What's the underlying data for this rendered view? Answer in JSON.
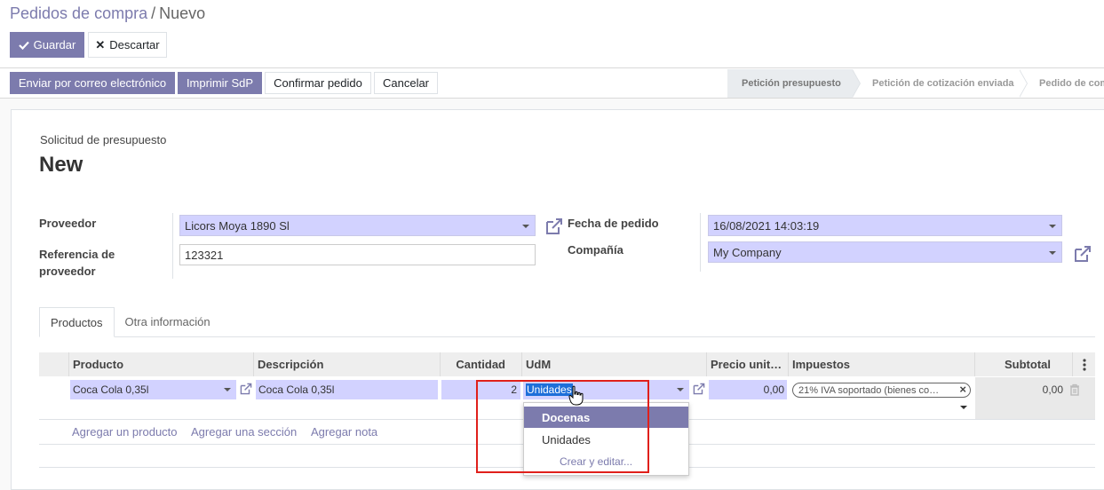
{
  "breadcrumb": {
    "parent": "Pedidos de compra",
    "separator": "/",
    "current": "Nuevo"
  },
  "toolbar": {
    "save_label": "Guardar",
    "discard_label": "Descartar"
  },
  "actions": {
    "email_label": "Enviar por correo electrónico",
    "print_label": "Imprimir SdP",
    "confirm_label": "Confirmar pedido",
    "cancel_label": "Cancelar"
  },
  "statusbar": [
    {
      "label": "Petición presupuesto",
      "active": true
    },
    {
      "label": "Petición de cotización enviada",
      "active": false
    },
    {
      "label": "Pedido de compra",
      "active": false
    }
  ],
  "form": {
    "subtitle": "Solicitud de presupuesto",
    "title": "New",
    "vendor_label": "Proveedor",
    "vendor_value": "Licors Moya 1890 Sl",
    "vendor_ref_label": "Referencia de proveedor",
    "vendor_ref_value": "123321",
    "order_date_label": "Fecha de pedido",
    "order_date_value": "16/08/2021 14:03:19",
    "company_label": "Compañía",
    "company_value": "My Company"
  },
  "tabs": [
    {
      "label": "Productos",
      "active": true
    },
    {
      "label": "Otra información",
      "active": false
    }
  ],
  "table": {
    "columns": [
      "Producto",
      "Descripción",
      "Cantidad",
      "UdM",
      "Precio unit…",
      "Impuestos",
      "Subtotal"
    ],
    "row": {
      "product": "Coca Cola 0,35l",
      "description": "Coca Cola 0,35l",
      "quantity": "2",
      "uom": "Unidades",
      "price": "0,00",
      "tax": "21% IVA soportado (bienes co…",
      "subtotal": "0,00"
    },
    "add_product": "Agregar un producto",
    "add_section": "Agregar una sección",
    "add_note": "Agregar nota"
  },
  "uom_dropdown": {
    "options": [
      "Docenas",
      "Unidades"
    ],
    "highlighted": "Docenas",
    "create_edit": "Crear y editar..."
  },
  "colors": {
    "primary": "#7c7bad",
    "required_field": "#d2d2ff",
    "highlight_box": "#e0201b"
  }
}
